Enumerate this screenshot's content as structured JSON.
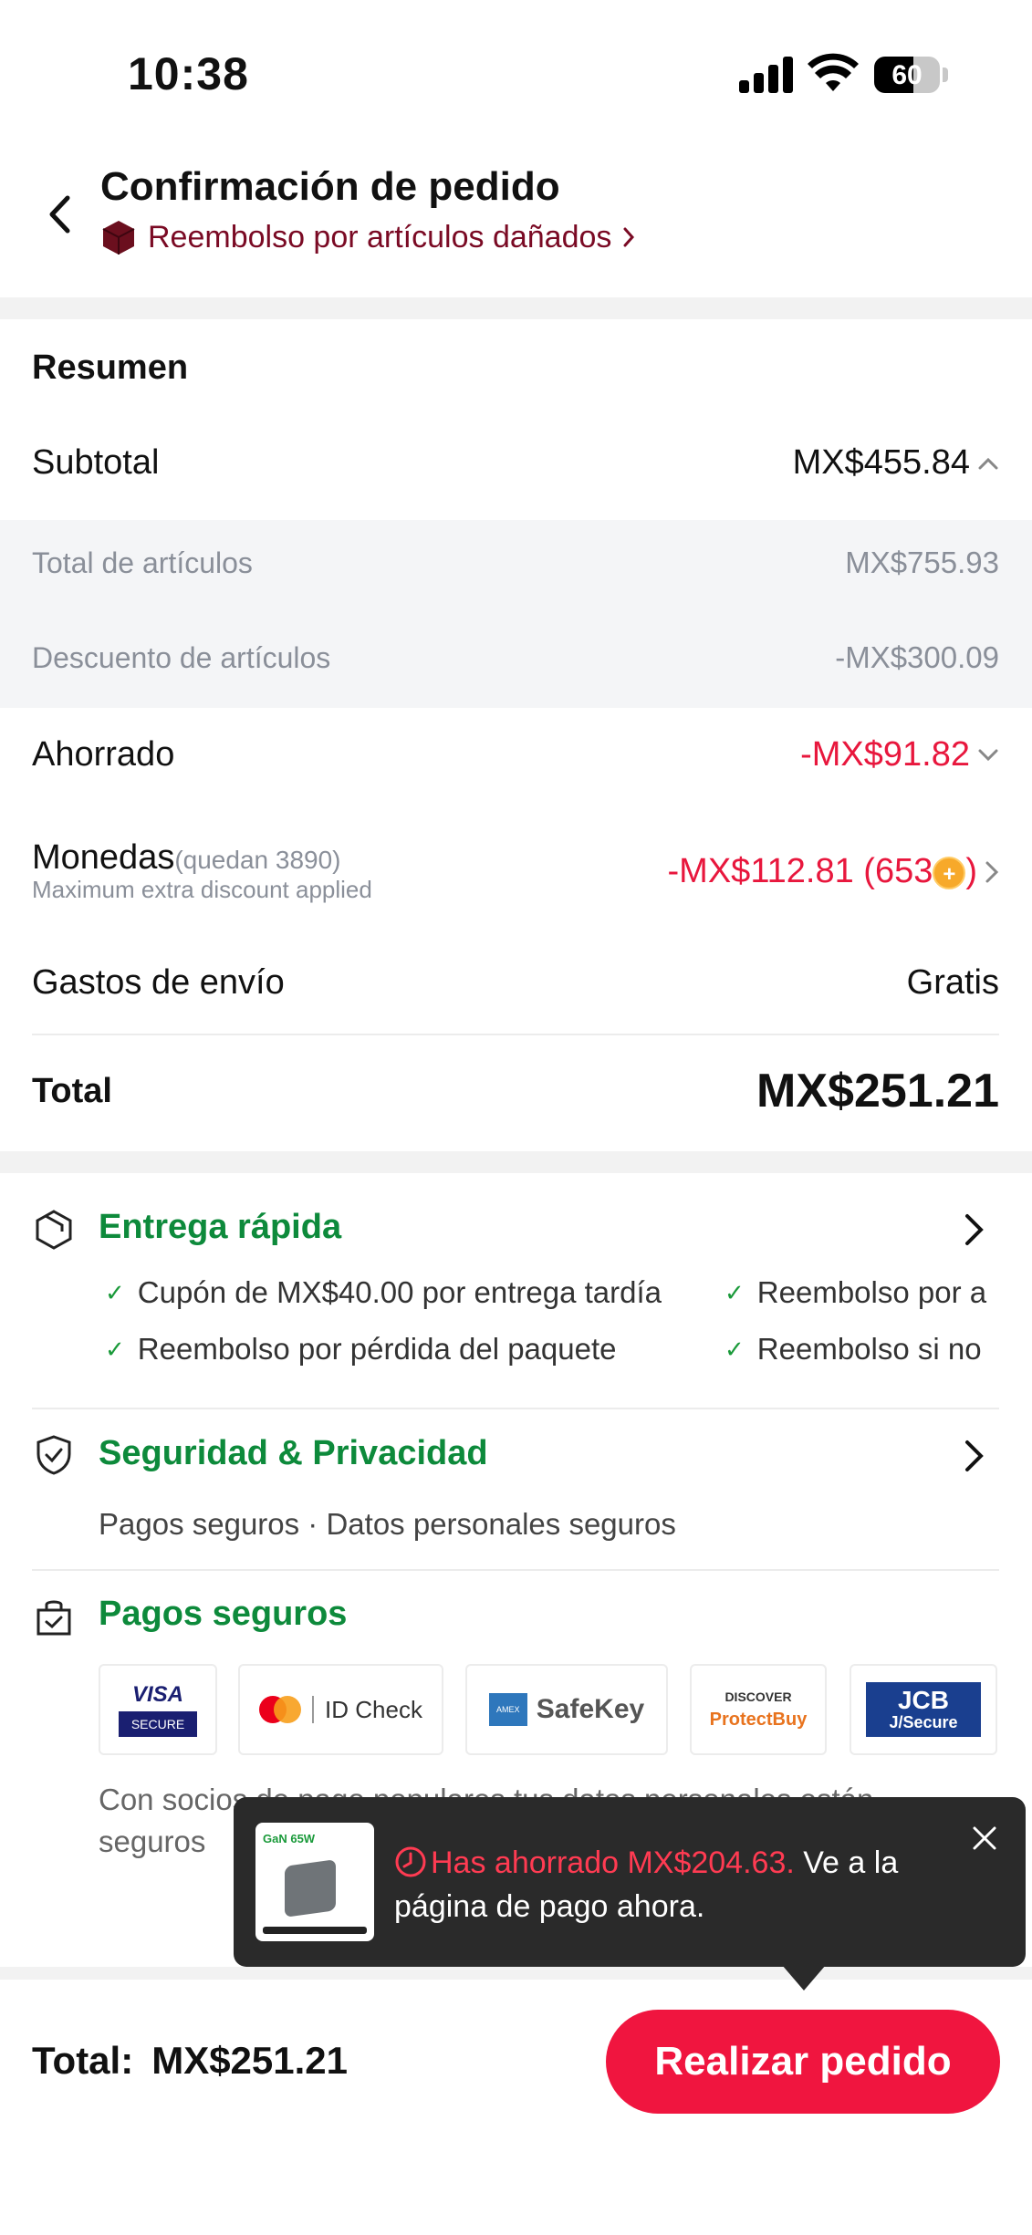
{
  "status_bar": {
    "time": "10:38",
    "battery": "60",
    "battery_level": 0.6
  },
  "header": {
    "title": "Confirmación de pedido",
    "refund_link": "Reembolso por artículos dañados"
  },
  "summary": {
    "title": "Resumen",
    "subtotal_label": "Subtotal",
    "subtotal_value": "MX$455.84",
    "items_total_label": "Total de artículos",
    "items_total_value": "MX$755.93",
    "items_discount_label": "Descuento de artículos",
    "items_discount_value": "-MX$300.09",
    "saved_label": "Ahorrado",
    "saved_value": "-MX$91.82",
    "coins_label": "Monedas",
    "coins_remaining": "(quedan 3890)",
    "coins_note": "Maximum extra discount applied",
    "coins_value": "-MX$112.81 (653",
    "coins_value_end": ")",
    "shipping_label": "Gastos de envío",
    "shipping_value": "Gratis",
    "total_label": "Total",
    "total_value": "MX$251.21"
  },
  "fast_delivery": {
    "title": "Entrega rápida",
    "items": [
      "Cupón de MX$40.00 por entrega tardía",
      "Reembolso por a",
      "Reembolso por pérdida del paquete",
      "Reembolso si no"
    ]
  },
  "security": {
    "title": "Seguridad & Privacidad",
    "text": "Pagos seguros · Datos personales seguros"
  },
  "secure_payments": {
    "title": "Pagos seguros",
    "logos": [
      {
        "line1": "VISA",
        "line2": "SECURE"
      },
      {
        "line1": "ID Check"
      },
      {
        "line1": "SafeKey"
      },
      {
        "line1": "DISCOVER",
        "line2": "ProtectBuy"
      },
      {
        "line1": "JCB",
        "line2": "J/Secure"
      }
    ],
    "partners_text": "Con socios de pago populares tus datos personales están seguros"
  },
  "toast": {
    "product_label": "GaN 65W",
    "highlight": "Has ahorrado MX$204.63.",
    "message": " Ve a la página de pago ahora."
  },
  "bottom_bar": {
    "total_label": "Total:",
    "total_value": "MX$251.21",
    "place_order": "Realizar pedido"
  },
  "colors": {
    "accent_red": "#f0153f",
    "discount_red": "#e8173d",
    "green": "#0d8a3b",
    "refund_link": "#7a0a24"
  }
}
